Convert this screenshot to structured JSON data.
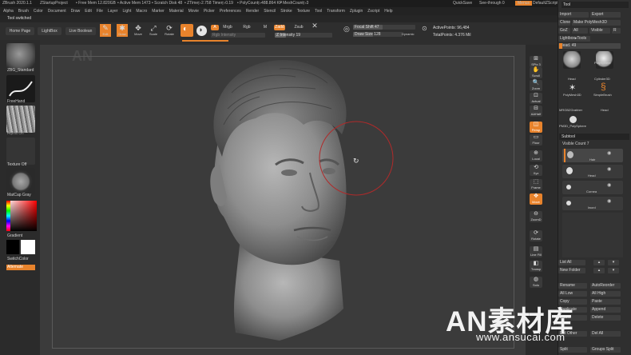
{
  "titlebar": {
    "app_title": "ZBrush 2020.1.1",
    "project": "ZStartupProject",
    "free_mem": "• Free Mem 12.820GB",
    "active_mem": "• Active Mem 1473",
    "scratch_disk": "• Scratch Disk 48",
    "ztime": "• ZTime▷2.758 Timer▷0.19",
    "polycount": "• PolyCount▷488.864 KP",
    "meshcount": "• MeshCount▷3",
    "quicksave": "QuickSave",
    "see_through": "See-through  0",
    "menus": "Menus",
    "default_zscript": "DefaultZScript"
  },
  "menubar": {
    "items": [
      "Alpha",
      "Brush",
      "Color",
      "Document",
      "Draw",
      "Edit",
      "File",
      "Layer",
      "Light",
      "Macro",
      "Marker",
      "Material",
      "Movie",
      "Picker",
      "Preferences",
      "Render",
      "Stencil",
      "Stroke",
      "Texture",
      "Tool",
      "Transform",
      "Zplugin",
      "Zscript",
      "Help"
    ]
  },
  "tool_switched": "Tool switched",
  "toolbar": {
    "home_page": "Home Page",
    "lightbox": "LightBox",
    "live_boolean": "Live Boolean",
    "edit": "Edit",
    "draw": "Draw",
    "move": "Move",
    "scale": "Scale",
    "rotate": "Rotate",
    "a_mode": "A",
    "mrgb": "Mrgb",
    "rgb": "Rgb",
    "m": "M",
    "zadd": "Zadd",
    "zsub": "Zsub",
    "rgb_intensity": "Rgb Intensity",
    "z_intensity": "Z Intensity  19",
    "focal_shift": "Focal Shift  47",
    "draw_size": "Draw Size  128",
    "dynamic": "Dynamic",
    "active_points": "ActivePoints: 96,484",
    "total_points": "TotalPoints: 4.376 Mil"
  },
  "left_shelf": {
    "brush_name": "ZBG_Standard",
    "stroke_name": "FreeHand",
    "alpha_name": "Alpha Off",
    "texture_name": "Texture Off",
    "material_name": "MatCap Gray",
    "gradient": "Gradient",
    "switch_color": "SwitchColor",
    "alternate": "Alternate"
  },
  "right_shelf": {
    "buttons": [
      "SPix 3",
      "Scroll",
      "Zoom",
      "Actual",
      "AAHalf",
      "Persp",
      "Floor",
      "Local",
      "Xyz",
      "Frame",
      "Move",
      "ZoomD",
      "Rotate",
      "Line Fill",
      "Transp",
      "Solo"
    ]
  },
  "right_tray": {
    "tool_label": "Tool",
    "import": "Import",
    "export": "Export",
    "clone": "Clone",
    "make_polymesh": "Make PolyMesh3D",
    "goz": "GoZ",
    "all": "All",
    "visible": "Visible",
    "r": "R",
    "lightbox_tools": "Lightbox▸Tools",
    "head_slider": "Head. 49",
    "tools": [
      "Head",
      "PolySphere",
      "Cylinder3D",
      "PolyMesh3D",
      "SimpleBrush",
      "MRGBZGrabber",
      "Head",
      "PM3D_PolySphere"
    ],
    "subtool_header": "Subtool",
    "visible_count": "Visible Count  7",
    "subtools": [
      "Hair",
      "Head",
      "Cornea",
      "Iword"
    ],
    "list_all": "List All",
    "new_folder": "New Folder",
    "rename": "Rename",
    "auto_reorder": "AutoReorder",
    "all_low": "All Low",
    "all_high": "All High",
    "copy": "Copy",
    "paste": "Paste",
    "duplicate": "Duplicate",
    "append": "Append",
    "insert": "Insert",
    "delete": "Delete",
    "del_other": "Del Other",
    "del_all": "Del All",
    "split": "Split",
    "groups_split": "Groups Split"
  },
  "watermark": {
    "logo": "AN素材库",
    "url": "www.ansucai.com",
    "center_mark": "AN"
  },
  "colors": {
    "accent": "#e8832c",
    "viewport": "#3b3b3b",
    "panel": "#2f2f2f"
  }
}
